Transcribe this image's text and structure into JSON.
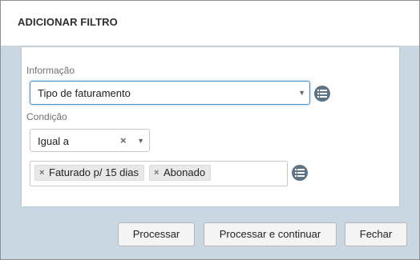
{
  "dialog": {
    "title": "ADICIONAR FILTRO"
  },
  "form": {
    "info_label": "Informação",
    "info_value": "Tipo de faturamento",
    "condition_label": "Condição",
    "condition_value": "Igual a",
    "values": [
      "Faturado p/ 15 dias",
      "Abonado"
    ]
  },
  "icons": {
    "caret": "caret-down-icon",
    "clear": "clear-x-icon",
    "list": "list-icon",
    "tag_remove": "tag-remove-x-icon"
  },
  "footer": {
    "process_label": "Processar",
    "process_continue_label": "Processar e continuar",
    "close_label": "Fechar"
  },
  "colors": {
    "footer_background": "#c8d7e1",
    "focus_border": "#4a90c6",
    "list_button": "#5e7486"
  }
}
